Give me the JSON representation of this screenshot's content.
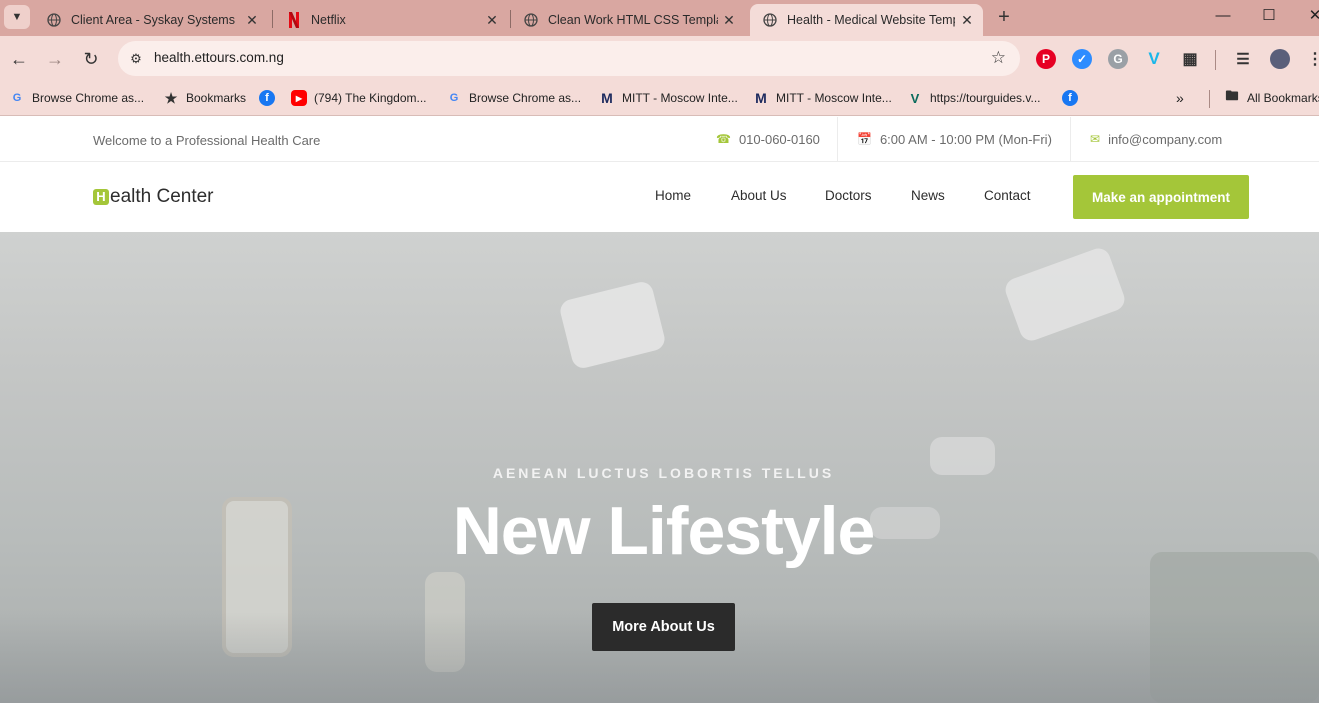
{
  "browser": {
    "tabs": [
      {
        "title": "Client Area - Syskay Systems",
        "icon": "globe-icon"
      },
      {
        "title": "Netflix",
        "icon": "netflix-icon"
      },
      {
        "title": "Clean Work HTML CSS Templat",
        "icon": "globe-icon"
      },
      {
        "title": "Health - Medical Website Temp",
        "icon": "globe-icon",
        "active": true
      }
    ],
    "url": "health.ettours.com.ng",
    "bookmarks": [
      {
        "label": "Browse Chrome as...",
        "icon": "google-icon"
      },
      {
        "label": "Bookmarks",
        "icon": "star-icon"
      },
      {
        "label": "",
        "icon": "facebook-icon"
      },
      {
        "label": "(794) The Kingdom...",
        "icon": "youtube-icon"
      },
      {
        "label": "Browse Chrome as...",
        "icon": "google-icon"
      },
      {
        "label": "MITT - Moscow Inte...",
        "icon": "mitt-icon"
      },
      {
        "label": "MITT - Moscow Inte...",
        "icon": "mitt-icon"
      },
      {
        "label": "https://tourguides.v...",
        "icon": "v-icon"
      },
      {
        "label": "",
        "icon": "facebook-icon"
      }
    ],
    "all_bookmarks": "All Bookmarks",
    "extensions": [
      "pinterest-icon",
      "zoom-icon",
      "grammarly-icon",
      "vimeo-icon",
      "puzzle-icon"
    ]
  },
  "site": {
    "topbar": {
      "welcome": "Welcome to a Professional Health Care",
      "phone": "010-060-0160",
      "hours": "6:00 AM - 10:00 PM (Mon-Fri)",
      "email": "info@company.com"
    },
    "logo": {
      "initial": "H",
      "rest": "ealth Center"
    },
    "nav": [
      "Home",
      "About Us",
      "Doctors",
      "News",
      "Contact"
    ],
    "cta": "Make an appointment",
    "hero": {
      "subtitle": "AENEAN LUCTUS LOBORTIS TELLUS",
      "title": "New Lifestyle",
      "button": "More About Us"
    }
  },
  "colors": {
    "accent": "#a4c639",
    "dark_button": "#2b2b2b",
    "tab_bar": "#d9a7a1",
    "toolbar": "#f4dcd8"
  }
}
